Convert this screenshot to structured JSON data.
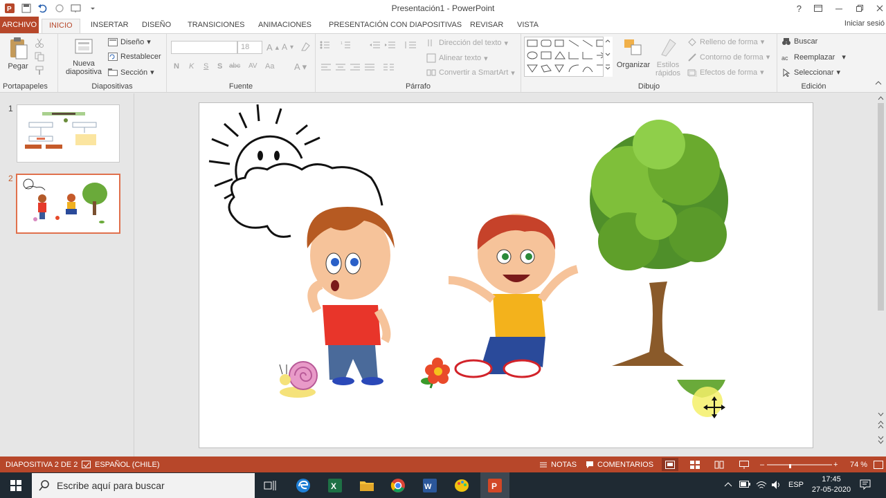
{
  "window": {
    "title": "Presentación1 - PowerPoint",
    "help": "?",
    "signin": "Iniciar sesió"
  },
  "tabs": {
    "archivo": "ARCHIVO",
    "inicio": "INICIO",
    "insertar": "INSERTAR",
    "diseno": "DISEÑO",
    "transiciones": "TRANSICIONES",
    "animaciones": "ANIMACIONES",
    "presentacion": "PRESENTACIÓN CON DIAPOSITIVAS",
    "revisar": "REVISAR",
    "vista": "VISTA"
  },
  "ribbon": {
    "portapapeles": {
      "label": "Portapapeles",
      "pegar": "Pegar"
    },
    "diapositivas": {
      "label": "Diapositivas",
      "nueva1": "Nueva",
      "nueva2": "diapositiva",
      "diseno": "Diseño",
      "restablecer": "Restablecer",
      "seccion": "Sección"
    },
    "fuente": {
      "label": "Fuente",
      "size": "18",
      "bold": "N",
      "italic": "K",
      "underline": "S",
      "shadow": "S",
      "strike": "abc",
      "spacing": "AV",
      "case": "Aa"
    },
    "parrafo": {
      "label": "Párrafo",
      "direccion": "Dirección del texto",
      "alinear": "Alinear texto",
      "smartart": "Convertir a SmartArt"
    },
    "dibujo": {
      "label": "Dibujo",
      "organizar": "Organizar",
      "estilos1": "Estilos",
      "estilos2": "rápidos",
      "relleno": "Relleno de forma",
      "contorno": "Contorno de forma",
      "efectos": "Efectos de forma"
    },
    "edicion": {
      "label": "Edición",
      "buscar": "Buscar",
      "reemplazar": "Reemplazar",
      "seleccionar": "Seleccionar"
    }
  },
  "thumbnails": [
    {
      "number": "1"
    },
    {
      "number": "2"
    }
  ],
  "statusbar": {
    "slide": "DIAPOSITIVA 2 DE 2",
    "lang": "ESPAÑOL (CHILE)",
    "notas": "NOTAS",
    "comentarios": "COMENTARIOS",
    "zoom": "74 %"
  },
  "taskbar": {
    "search_placeholder": "Escribe aquí para buscar",
    "lang": "ESP",
    "time": "17:45",
    "date": "27-05-2020"
  },
  "colors": {
    "accent": "#b7472a",
    "taskbar": "#1f2a33"
  }
}
